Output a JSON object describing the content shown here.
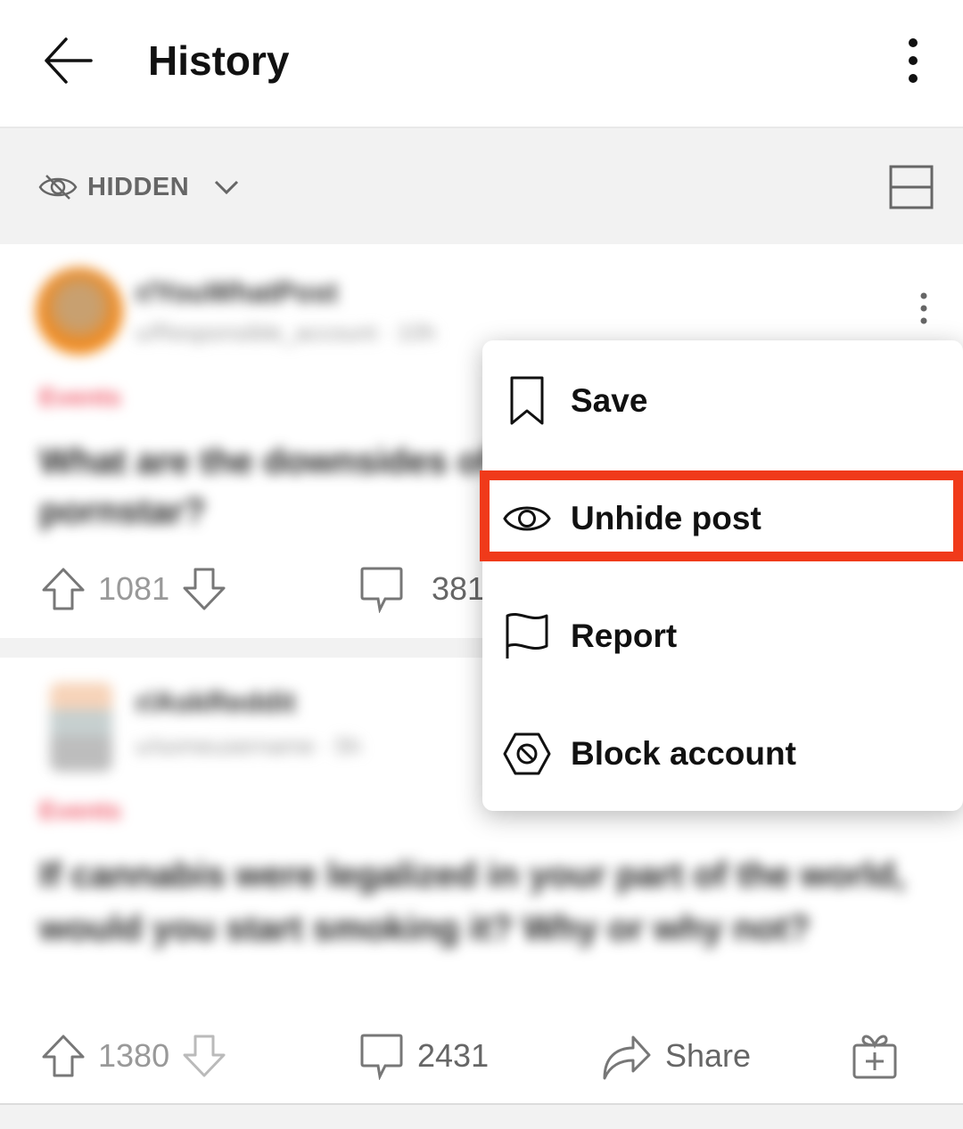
{
  "header": {
    "title": "History",
    "back_icon": "arrow-left-icon",
    "menu_icon": "more-vertical-icon"
  },
  "filter": {
    "label": "HIDDEN",
    "icon": "eye-off-icon",
    "dropdown_icon": "chevron-down-icon",
    "layout_icon": "card-layout-icon"
  },
  "posts": [
    {
      "subreddit": "r/YouWhatPost",
      "meta": "u/Responsible_account · 10h",
      "flair": "Events",
      "title": "What are the downsides of being a pornstar?",
      "upvotes": "1081",
      "comments": "381"
    },
    {
      "subreddit": "r/AskReddit",
      "meta": "u/someusername · 5h",
      "flair": "Events",
      "title": "If cannabis were legalized in your part of the world, would you start smoking it? Why or why not?",
      "upvotes": "1380",
      "comments": "2431",
      "share_label": "Share"
    }
  ],
  "context_menu": {
    "items": [
      {
        "label": "Save",
        "icon": "bookmark-icon"
      },
      {
        "label": "Unhide post",
        "icon": "eye-icon",
        "highlighted": true
      },
      {
        "label": "Report",
        "icon": "flag-icon"
      },
      {
        "label": "Block account",
        "icon": "block-icon"
      }
    ]
  },
  "colors": {
    "highlight_border": "#f03a1a",
    "flair": "#f05a6a",
    "background": "#f2f2f2"
  }
}
